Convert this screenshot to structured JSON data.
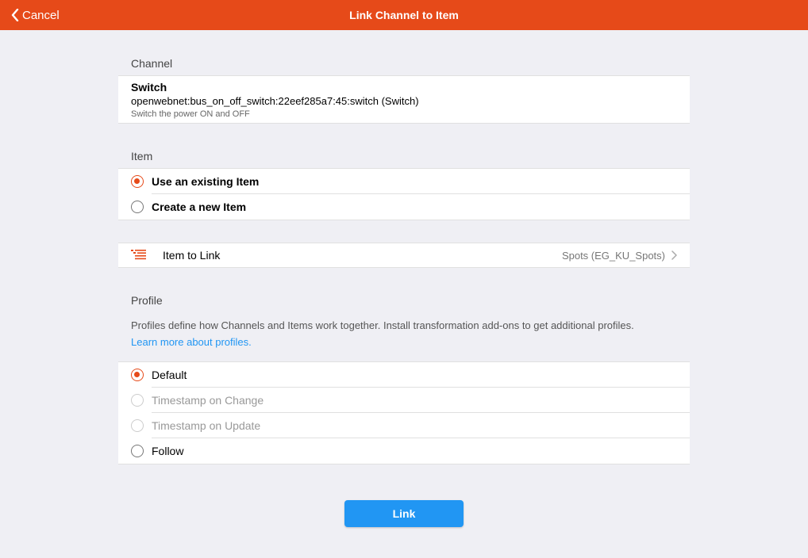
{
  "nav": {
    "back_label": "Cancel",
    "title": "Link Channel to Item",
    "bar_color": "#e64a19",
    "back_icon": "chevron-left-icon"
  },
  "channel": {
    "heading": "Channel",
    "title": "Switch",
    "subtitle": "openwebnet:bus_on_off_switch:22eef285a7:45:switch (Switch)",
    "description": "Switch the power ON and OFF"
  },
  "item": {
    "heading": "Item",
    "options": [
      {
        "label": "Use an existing Item",
        "checked": true,
        "disabled": false
      },
      {
        "label": "Create a new Item",
        "checked": false,
        "disabled": false
      }
    ],
    "link": {
      "icon": "list-icon",
      "label": "Item to Link",
      "value": "Spots (EG_KU_Spots)"
    }
  },
  "profile": {
    "heading": "Profile",
    "description": "Profiles define how Channels and Items work together. Install transformation add-ons to get additional profiles.",
    "learn_more": "Learn more about profiles.",
    "options": [
      {
        "label": "Default",
        "checked": true,
        "disabled": false
      },
      {
        "label": "Timestamp on Change",
        "checked": false,
        "disabled": true
      },
      {
        "label": "Timestamp on Update",
        "checked": false,
        "disabled": true
      },
      {
        "label": "Follow",
        "checked": false,
        "disabled": false
      }
    ]
  },
  "actions": {
    "link_label": "Link",
    "link_color": "#2196f3"
  }
}
